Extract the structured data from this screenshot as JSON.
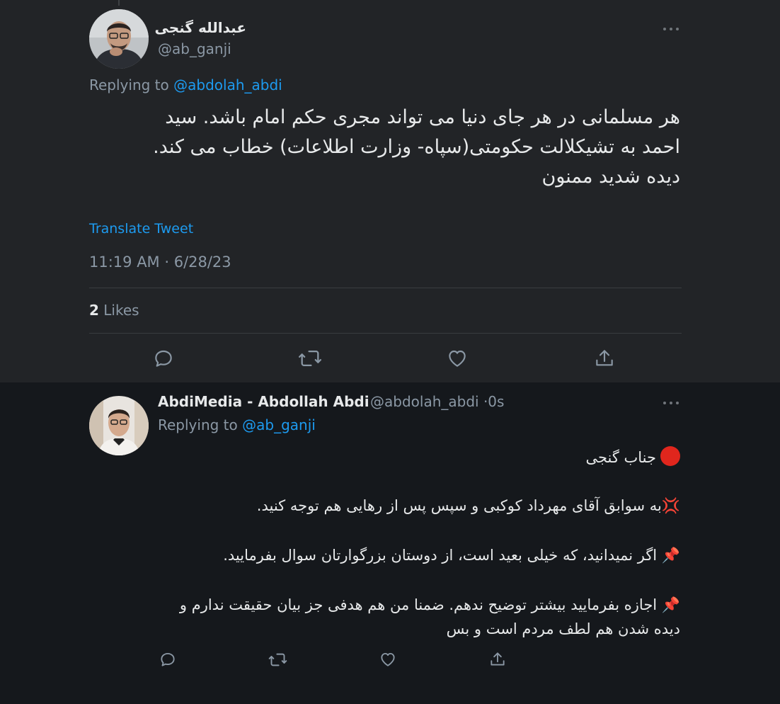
{
  "original_tweet": {
    "author_name": "عبدالله گنجی",
    "handle": "@ab_ganji",
    "replying_prefix": "Replying to ",
    "replying_to": "@abdolah_abdi",
    "text_lines": [
      "هر مسلمانی در هر جای دنیا می تواند مجری حکم امام  باشد. سید",
      "احمد به تشیکلالت حکومتی(سپاه- وزارت اطلاعات) خطاب می کند.",
      "دیده شدید ممنون"
    ],
    "translate_label": "Translate Tweet",
    "timestamp": "11:19 AM · 6/28/23",
    "likes_count": "2",
    "likes_label": "Likes"
  },
  "reply_tweet": {
    "author_name": "AbdiMedia - Abdollah Abdi",
    "handle": "@abdolah_abdi",
    "separator": "·",
    "time": "0s",
    "replying_prefix": "Replying to ",
    "replying_to": "@ab_ganji",
    "lines": {
      "line1": "جناب گنجی",
      "line2": "به سوابق آقای مهرداد کوکبی و سپس پس از رهایی هم توجه کنید.",
      "line3": "اگر نمیدانید، که خیلی بعید است، از دوستان بزرگوارتان سوال بفرمایید.",
      "line4": "اجازه بفرمایید بیشتر توضیح ندهم. ضمنا من هم هدفی جز بیان حقیقت ندارم و",
      "line5": "دیده شدن هم لطف مردم است و بس"
    },
    "emoji": {
      "anger": "💢",
      "pin": "📌"
    }
  },
  "colors": {
    "link": "#1d9bf0",
    "secondary_text": "#8b98a5",
    "top_background": "#222427",
    "bottom_background": "#15181c"
  },
  "icons": [
    "more-icon",
    "reply-icon",
    "retweet-icon",
    "like-icon",
    "share-icon"
  ]
}
